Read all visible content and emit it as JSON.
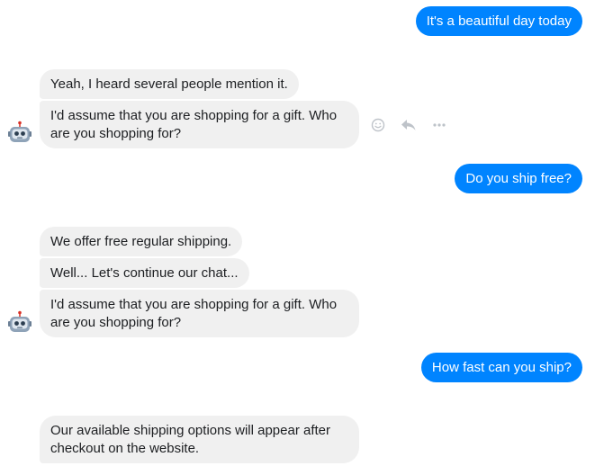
{
  "messages": {
    "m1": "It's a beautiful day today",
    "m2": "Yeah, I heard several people mention it.",
    "m3": "I'd assume that you are shopping for a gift. Who are you shopping for?",
    "m4": "Do you ship free?",
    "m5": "We offer free regular shipping.",
    "m6": "Well... Let's continue our chat...",
    "m7": "I'd assume that you are shopping for a gift. Who are you shopping for?",
    "m8": "How fast can you ship?",
    "m9": "Our available shipping options will appear after checkout on the website."
  },
  "icons": {
    "avatar": "robot-icon",
    "react": "smiley-icon",
    "reply": "reply-arrow-icon",
    "more": "more-dots-icon"
  },
  "colors": {
    "outgoing_bubble": "#0084ff",
    "incoming_bubble": "#f0f0f0",
    "action_icon": "#bec3c9"
  }
}
